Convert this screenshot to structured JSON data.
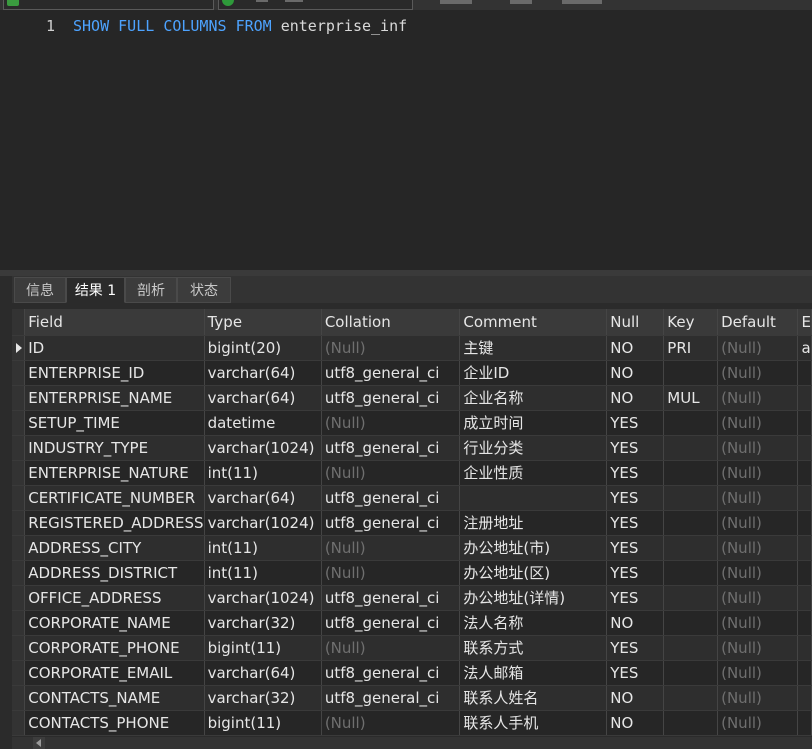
{
  "editor": {
    "line_number": "1",
    "sql_keywords": [
      "SHOW",
      "FULL",
      "COLUMNS",
      "FROM"
    ],
    "sql_table": "enterprise_inf"
  },
  "tabs": [
    "信息",
    "结果 1",
    "剖析",
    "状态"
  ],
  "active_tab": 1,
  "columns": [
    "Field",
    "Type",
    "Collation",
    "Comment",
    "Null",
    "Key",
    "Default",
    "E"
  ],
  "rows": [
    [
      "ID",
      "bigint(20)",
      "(Null)",
      "主键",
      "NO",
      "PRI",
      "(Null)",
      "a"
    ],
    [
      "ENTERPRISE_ID",
      "varchar(64)",
      "utf8_general_ci",
      "企业ID",
      "NO",
      "",
      "(Null)",
      ""
    ],
    [
      "ENTERPRISE_NAME",
      "varchar(64)",
      "utf8_general_ci",
      "企业名称",
      "NO",
      "MUL",
      "(Null)",
      ""
    ],
    [
      "SETUP_TIME",
      "datetime",
      "(Null)",
      "成立时间",
      "YES",
      "",
      "(Null)",
      ""
    ],
    [
      "INDUSTRY_TYPE",
      "varchar(1024)",
      "utf8_general_ci",
      "行业分类",
      "YES",
      "",
      "(Null)",
      ""
    ],
    [
      "ENTERPRISE_NATURE",
      "int(11)",
      "(Null)",
      "企业性质",
      "YES",
      "",
      "(Null)",
      ""
    ],
    [
      "CERTIFICATE_NUMBER",
      "varchar(64)",
      "utf8_general_ci",
      "",
      "YES",
      "",
      "(Null)",
      ""
    ],
    [
      "REGISTERED_ADDRESS",
      "varchar(1024)",
      "utf8_general_ci",
      "注册地址",
      "YES",
      "",
      "(Null)",
      ""
    ],
    [
      "ADDRESS_CITY",
      "int(11)",
      "(Null)",
      "办公地址(市)",
      "YES",
      "",
      "(Null)",
      ""
    ],
    [
      "ADDRESS_DISTRICT",
      "int(11)",
      "(Null)",
      "办公地址(区)",
      "YES",
      "",
      "(Null)",
      ""
    ],
    [
      "OFFICE_ADDRESS",
      "varchar(1024)",
      "utf8_general_ci",
      "办公地址(详情)",
      "YES",
      "",
      "(Null)",
      ""
    ],
    [
      "CORPORATE_NAME",
      "varchar(32)",
      "utf8_general_ci",
      "法人名称",
      "NO",
      "",
      "(Null)",
      ""
    ],
    [
      "CORPORATE_PHONE",
      "bigint(11)",
      "(Null)",
      "联系方式",
      "YES",
      "",
      "(Null)",
      ""
    ],
    [
      "CORPORATE_EMAIL",
      "varchar(64)",
      "utf8_general_ci",
      "法人邮箱",
      "YES",
      "",
      "(Null)",
      ""
    ],
    [
      "CONTACTS_NAME",
      "varchar(32)",
      "utf8_general_ci",
      "联系人姓名",
      "NO",
      "",
      "(Null)",
      ""
    ],
    [
      "CONTACTS_PHONE",
      "bigint(11)",
      "(Null)",
      "联系人手机",
      "NO",
      "",
      "(Null)",
      ""
    ]
  ],
  "null_label": "(Null)",
  "colors": {
    "keyword": "#4da3ff",
    "null_text": "#6f6f6f",
    "background": "#2b2b2b"
  },
  "icons": {
    "current_row": "row-pointer-icon",
    "scroll_left": "scroll-left-icon"
  }
}
